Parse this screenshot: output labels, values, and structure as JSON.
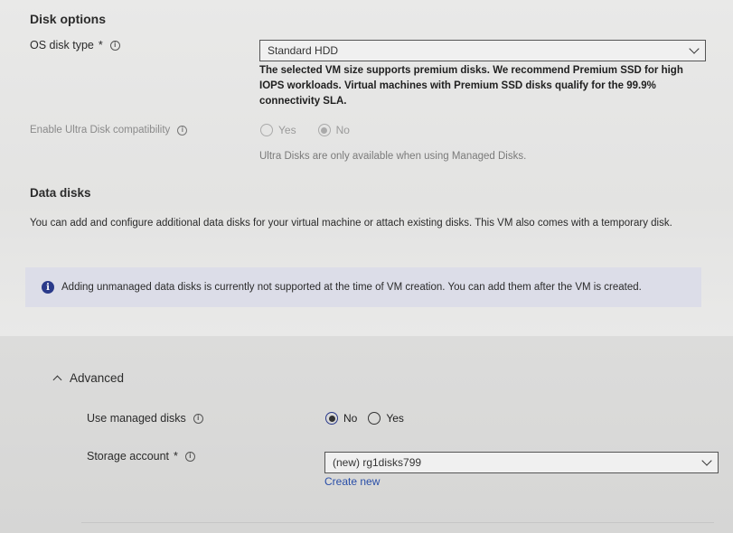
{
  "disk_options": {
    "title": "Disk options",
    "os_disk_type": {
      "label": "OS disk type",
      "required_mark": "*",
      "value": "Standard HDD",
      "help": "The selected VM size supports premium disks. We recommend Premium SSD for high IOPS workloads. Virtual machines with Premium SSD disks qualify for the 99.9% connectivity SLA."
    },
    "ultra_disk": {
      "label": "Enable Ultra Disk compatibility",
      "options": [
        "Yes",
        "No"
      ],
      "selected": "No",
      "note": "Ultra Disks are only available when using Managed Disks."
    }
  },
  "data_disks": {
    "title": "Data disks",
    "description": "You can add and configure additional data disks for your virtual machine or attach existing disks. This VM also comes with a temporary disk.",
    "banner_text": "Adding unmanaged data disks is currently not supported at the time of VM creation. You can add them after the VM is created."
  },
  "advanced": {
    "title": "Advanced",
    "use_managed_disks": {
      "label": "Use managed disks",
      "options": [
        "No",
        "Yes"
      ],
      "selected": "No"
    },
    "storage_account": {
      "label": "Storage account",
      "required_mark": "*",
      "value": "(new) rg1disks799",
      "create_new": "Create new"
    }
  },
  "icons": {
    "info": "info-circle-icon",
    "banner": "info-filled-icon",
    "dropdown": "chevron-down-icon",
    "collapse": "chevron-up-icon"
  },
  "colors": {
    "banner_bg": "#dcdde8",
    "banner_icon": "#2a3a8a",
    "link": "#2a4fa8"
  }
}
